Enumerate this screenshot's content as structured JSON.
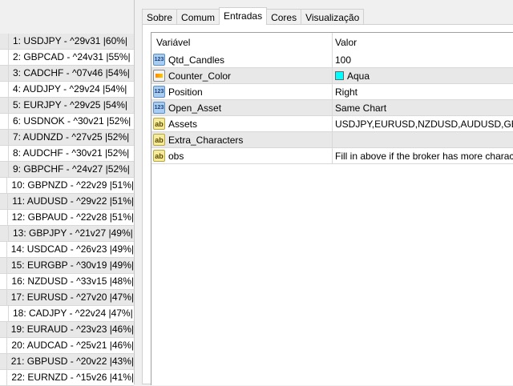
{
  "ranking": [
    "1: USDJPY - ^29v31 |60%|",
    "2: GBPCAD - ^24v31 |55%|",
    "3: CADCHF - ^07v46 |54%|",
    "4: AUDJPY - ^29v24 |54%|",
    "5: EURJPY - ^29v25 |54%|",
    "6: USDNOK - ^30v21 |52%|",
    "7: AUDNZD - ^27v25 |52%|",
    "8: AUDCHF - ^30v21 |52%|",
    "9: GBPCHF - ^24v27 |52%|",
    "10: GBPNZD - ^22v29 |51%|",
    "11: AUDUSD - ^29v22 |51%|",
    "12: GBPAUD - ^22v28 |51%|",
    "13: GBPJPY - ^21v27 |49%|",
    "14: USDCAD - ^26v23 |49%|",
    "15: EURGBP - ^30v19 |49%|",
    "16: NZDUSD - ^33v15 |48%|",
    "17: EURUSD - ^27v20 |47%|",
    "18: CADJPY - ^22v24 |47%|",
    "19: EURAUD - ^23v23 |46%|",
    "20: AUDCAD - ^25v21 |46%|",
    "21: GBPUSD - ^20v22 |43%|",
    "22: EURNZD - ^15v26 |41%|"
  ],
  "tabs": [
    {
      "label": "Sobre"
    },
    {
      "label": "Comum"
    },
    {
      "label": "Entradas",
      "active": true
    },
    {
      "label": "Cores"
    },
    {
      "label": "Visualização"
    }
  ],
  "grid": {
    "headers": {
      "variable": "Variável",
      "value": "Valor"
    },
    "rows": [
      {
        "icon": "num",
        "name": "Qtd_Candles",
        "value": "100"
      },
      {
        "icon": "color",
        "name": "Counter_Color",
        "value": "Aqua",
        "swatch": "#00ffff"
      },
      {
        "icon": "num",
        "name": "Position",
        "value": "Right"
      },
      {
        "icon": "num",
        "name": "Open_Asset",
        "value": "Same Chart"
      },
      {
        "icon": "str",
        "name": "Assets",
        "value": "USDJPY,EURUSD,NZDUSD,AUDUSD,GB..."
      },
      {
        "icon": "str",
        "name": "Extra_Characters",
        "value": ""
      },
      {
        "icon": "str",
        "name": "obs",
        "value": "Fill in above if the broker has more character..."
      }
    ]
  }
}
